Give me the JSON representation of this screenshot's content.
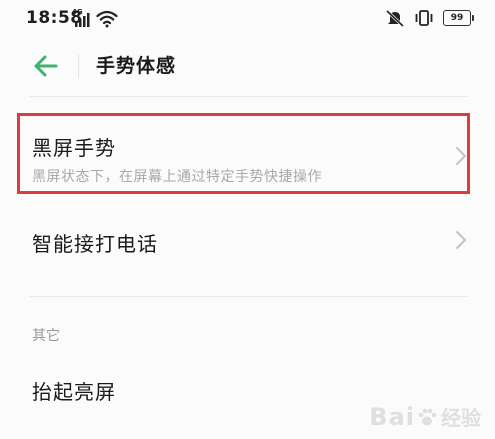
{
  "status_bar": {
    "time": "18:58",
    "network_label": "4G",
    "battery_level": "99"
  },
  "header": {
    "title": "手势体感"
  },
  "items": [
    {
      "title": "黑屏手势",
      "subtitle": "黑屏状态下，在屏幕上通过特定手势快捷操作"
    },
    {
      "title": "智能接打电话"
    }
  ],
  "section": {
    "label": "其它"
  },
  "items_other": [
    {
      "title": "抬起亮屏"
    }
  ],
  "watermark": {
    "brand": "Bai",
    "brand_suffix": "经验"
  },
  "colors": {
    "accent": "#3cb371",
    "highlight": "#e03a41",
    "subtitle": "#a8a8a8"
  }
}
